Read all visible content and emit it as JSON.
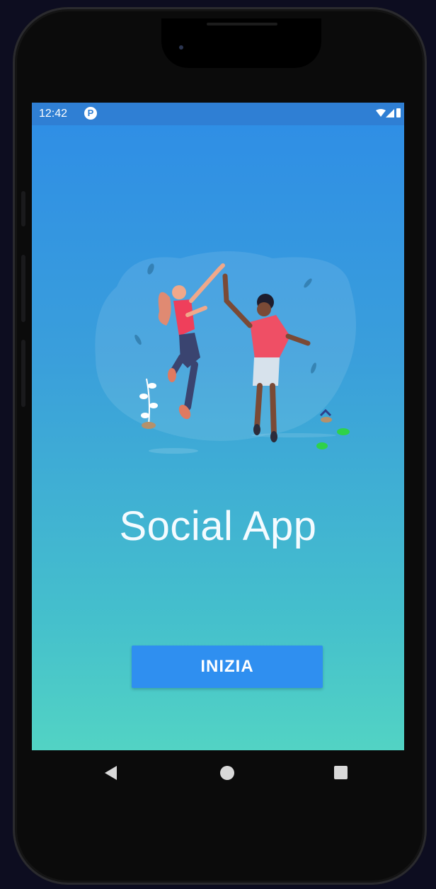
{
  "status_bar": {
    "time": "12:42",
    "notification_icon": "p-circle-icon",
    "wifi_icon": "wifi-icon",
    "signal_icon": "signal-icon",
    "battery_icon": "battery-icon"
  },
  "main": {
    "illustration": "high-five-people-illustration",
    "title": "Social App",
    "start_button_label": "INIZIA"
  },
  "nav_bar": {
    "back_icon": "back-triangle-icon",
    "home_icon": "home-circle-icon",
    "recent_icon": "recent-square-icon"
  },
  "colors": {
    "gradient_top": "#2e8de6",
    "gradient_bottom": "#52d3c4",
    "status_bar": "#2f7fd4",
    "button": "#2f8ff0",
    "text": "#ffffff"
  }
}
